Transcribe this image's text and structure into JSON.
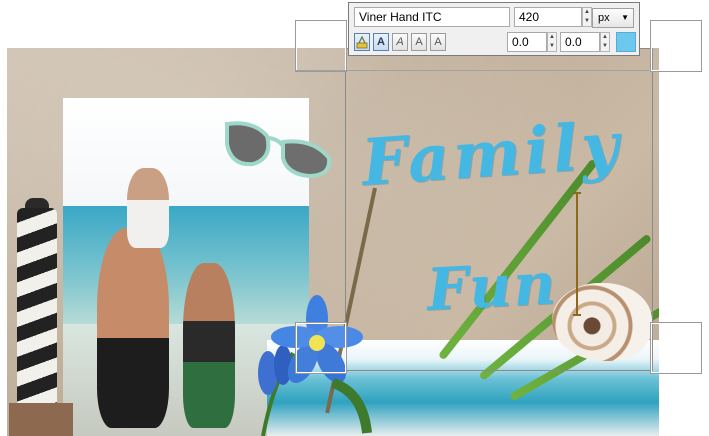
{
  "canvas": {
    "title_line1": "Family",
    "title_line2": "Fun"
  },
  "toolbar": {
    "font_name": "Viner Hand ITC",
    "font_size": "420",
    "unit": "px",
    "offset_x": "0.0",
    "offset_y": "0.0",
    "text_color": "#6cc8ec",
    "style_buttons": [
      {
        "glyph": "A",
        "name": "fill"
      },
      {
        "glyph": "A",
        "name": "bold"
      },
      {
        "glyph": "A",
        "name": "italic"
      },
      {
        "glyph": "A",
        "name": "outline"
      },
      {
        "glyph": "A",
        "name": "shadow"
      }
    ]
  },
  "colors": {
    "title": "#45b7e3",
    "selection_frame": "#8a8a8a",
    "toolbar_bg": "#f0f0f0"
  }
}
